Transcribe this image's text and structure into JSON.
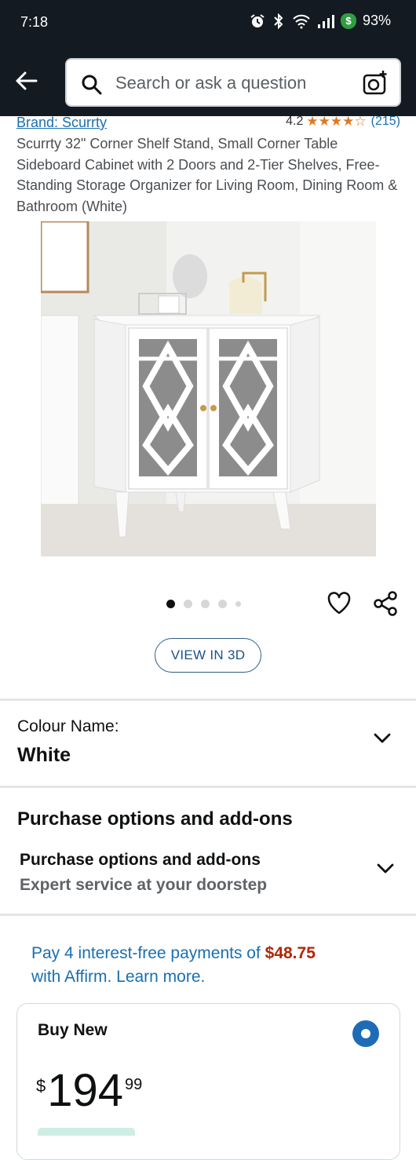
{
  "status_bar": {
    "time": "7:18",
    "battery": "93%"
  },
  "search": {
    "placeholder": "Search or ask a question"
  },
  "product": {
    "brand": "Brand: Scurrty",
    "rating": "4.2",
    "rating_value": 4.2,
    "review_count": "(215)",
    "title": "Scurrty 32\" Corner Shelf Stand, Small Corner Table Sideboard Cabinet with 2 Doors and 2-Tier Shelves, Free-Standing Storage Organizer for Living Room, Dining Room & Bathroom (White)"
  },
  "gallery": {
    "image_count": 5,
    "active_index": 0,
    "view_3d_label": "VIEW IN 3D"
  },
  "colour": {
    "label": "Colour Name:",
    "value": "White"
  },
  "purchase_options": {
    "heading": "Purchase options and add-ons",
    "item_title": "Purchase options and add-ons",
    "item_desc": "Expert service at your doorstep"
  },
  "affirm": {
    "prefix": "Pay 4 interest-free payments of ",
    "amount": "$48.75",
    "suffix": "with Affirm. Learn more."
  },
  "buy_box": {
    "label": "Buy New",
    "currency": "$",
    "price_whole": "194",
    "price_fraction": "99"
  },
  "colors": {
    "header_bg": "#131a22",
    "link": "#1a6fb0",
    "star": "#de7921",
    "price_accent": "#b12704"
  }
}
